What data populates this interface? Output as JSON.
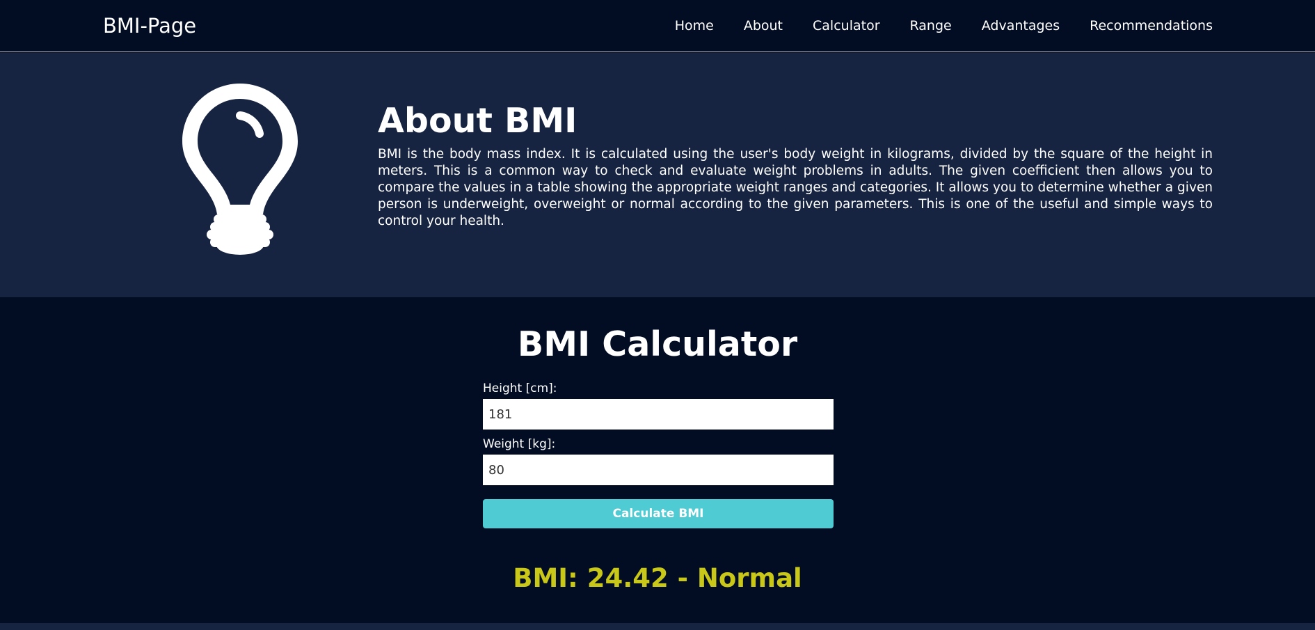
{
  "nav": {
    "brand": "BMI-Page",
    "links": [
      "Home",
      "About",
      "Calculator",
      "Range",
      "Advantages",
      "Recommendations"
    ]
  },
  "about": {
    "icon": "lightbulb-icon",
    "title": "About BMI",
    "body": "BMI is the body mass index. It is calculated using the user's body weight in kilograms, divided by the square of the height in meters. This is a common way to check and evaluate weight problems in adults. The given coefficient then allows you to compare the values in a table showing the appropriate weight ranges and categories. It allows you to determine whether a given person is underweight, overweight or normal according to the given parameters. This is one of the useful and simple ways to control your health."
  },
  "calculator": {
    "title": "BMI Calculator",
    "height_label": "Height [cm]:",
    "height_value": "181",
    "weight_label": "Weight [kg]:",
    "weight_value": "80",
    "button_label": "Calculate BMI",
    "result": "BMI: 24.42 - Normal"
  },
  "colors": {
    "background": "#020d24",
    "about_background": "#172441",
    "button": "#4ecbd3",
    "result": "#c9c717"
  }
}
